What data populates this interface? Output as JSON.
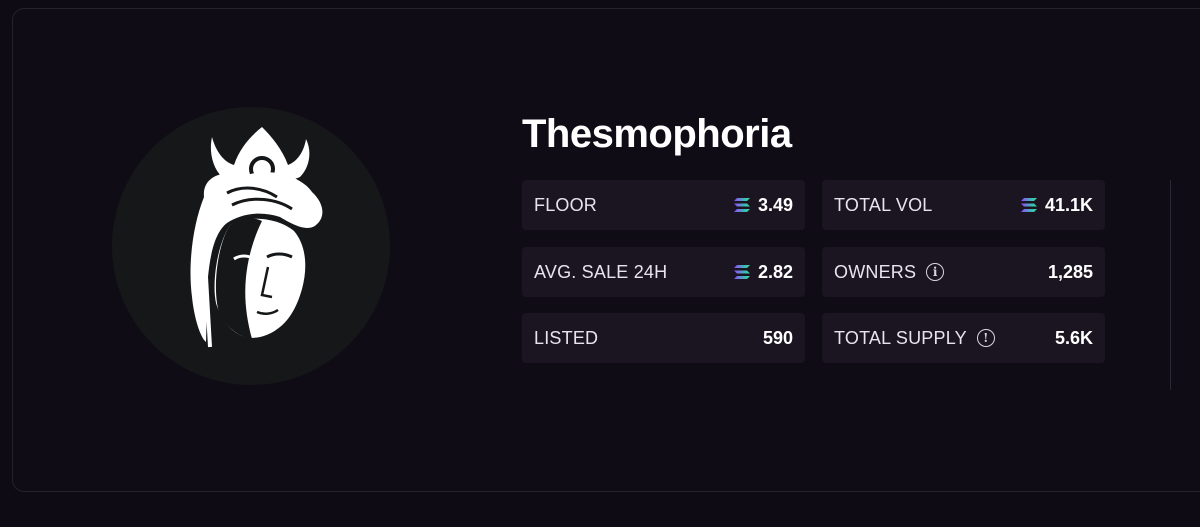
{
  "collection": {
    "name": "Thesmophoria",
    "avatar_icon": "goddess-portrait-icon"
  },
  "stats": {
    "floor": {
      "label": "FLOOR",
      "value": "3.49",
      "icon": "solana-icon"
    },
    "total_vol": {
      "label": "TOTAL VOL",
      "value": "41.1K",
      "icon": "solana-icon"
    },
    "avg_sale": {
      "label": "AVG. SALE 24H",
      "value": "2.82",
      "icon": "solana-icon"
    },
    "owners": {
      "label": "OWNERS",
      "value": "1,285",
      "icon": "info-icon"
    },
    "listed": {
      "label": "LISTED",
      "value": "590"
    },
    "total_supply": {
      "label": "TOTAL SUPPLY",
      "value": "5.6K",
      "icon": "alert-icon"
    }
  },
  "colors": {
    "background": "#0e0b14",
    "stat_bg": "#1b1522",
    "solana_gradient_start": "#9945ff",
    "solana_gradient_end": "#14f195"
  }
}
